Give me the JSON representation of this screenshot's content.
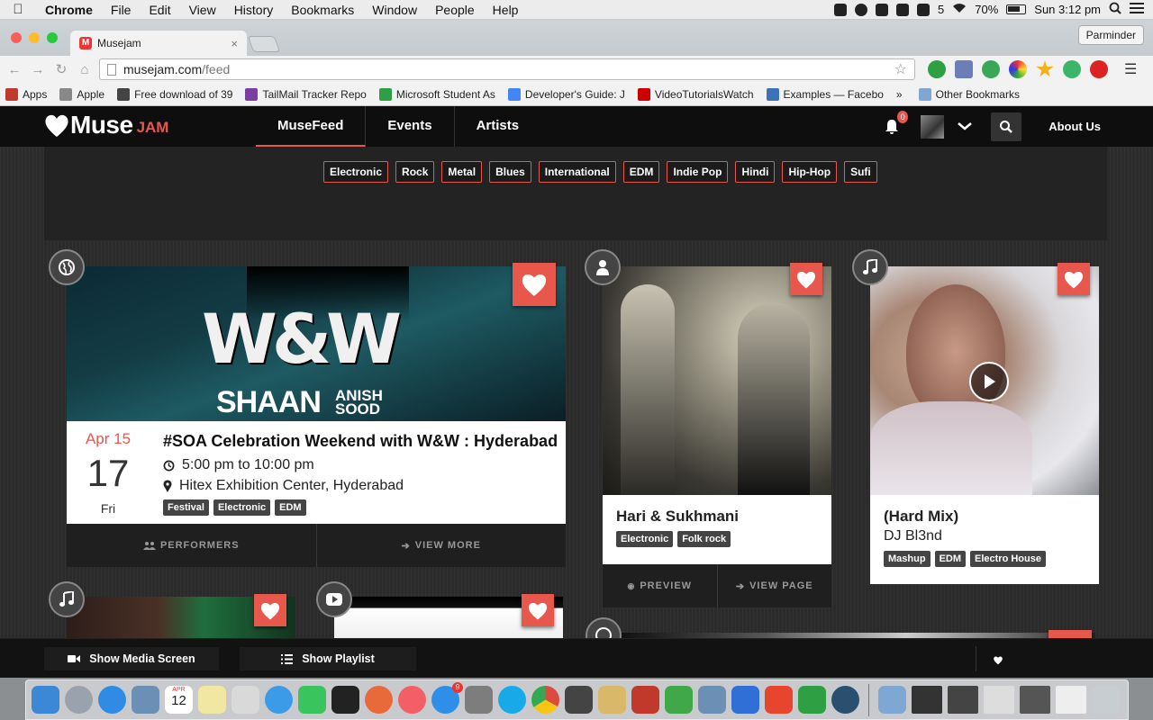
{
  "menubar": {
    "app": "Chrome",
    "items": [
      "File",
      "Edit",
      "View",
      "History",
      "Bookmarks",
      "Window",
      "People",
      "Help"
    ],
    "status_count": "5",
    "battery": "70%",
    "clock": "Sun 3:12 pm"
  },
  "browser": {
    "tab_title": "Musejam",
    "tab_close": "×",
    "profile": "Parminder",
    "url_host": "musejam.com",
    "url_path": "/feed",
    "bookmarks": [
      {
        "label": "Apps",
        "color": "#c0392b"
      },
      {
        "label": "Apple",
        "color": "#888888"
      },
      {
        "label": "Free download of 39",
        "color": "#444444"
      },
      {
        "label": "TailMail Tracker Repo",
        "color": "#7a3fa0"
      },
      {
        "label": "Microsoft Student As",
        "color": "#2ea043"
      },
      {
        "label": "Developer's Guide: J",
        "color": "#4285f4"
      },
      {
        "label": "VideoTutorialsWatch",
        "color": "#cc0000"
      },
      {
        "label": "Examples — Facebo",
        "color": "#3b73b9"
      }
    ],
    "bookmarks_more": "»",
    "other_bookmarks": "Other Bookmarks"
  },
  "site": {
    "logo_muse": "Muse",
    "logo_jam": "JAM",
    "nav": [
      {
        "label": "MuseFeed",
        "active": true
      },
      {
        "label": "Events",
        "active": false
      },
      {
        "label": "Artists",
        "active": false
      }
    ],
    "notif_count": "0",
    "about": "About Us"
  },
  "genres": [
    "Electronic",
    "Rock",
    "Metal",
    "Blues",
    "International",
    "EDM",
    "Indie Pop",
    "Hindi",
    "Hip-Hop",
    "Sufi"
  ],
  "event_card": {
    "poster_title": "W&W",
    "poster_line1": "SHAAN",
    "poster_line2a": "ANISH",
    "poster_line2b": "SOOD",
    "month_day": "Apr 15",
    "day": "17",
    "weekday": "Fri",
    "title": "#SOA Celebration Weekend with W&W : Hyderabad",
    "time": "5:00 pm to 10:00 pm",
    "venue": "Hitex Exhibition Center, Hyderabad",
    "tags": [
      "Festival",
      "Electronic",
      "EDM"
    ],
    "actions": [
      "PERFORMERS",
      "VIEW MORE"
    ]
  },
  "artist_card": {
    "title": "Hari & Sukhmani",
    "tags": [
      "Electronic",
      "Folk rock"
    ],
    "actions": [
      "PREVIEW",
      "VIEW PAGE"
    ]
  },
  "song_card": {
    "title": "(Hard Mix)",
    "artist": "DJ Bl3nd",
    "tags": [
      "Mashup",
      "EDM",
      "Electro House"
    ]
  },
  "mediabar": {
    "show_media": "Show Media Screen",
    "show_playlist": "Show Playlist"
  },
  "dock": {
    "calendar_day": "12",
    "calendar_month": "APR",
    "appstore_badge": "9",
    "app_colors": [
      "#3c87d6",
      "#9aa3ad",
      "#2f8be3",
      "#6b8fb5",
      "#f1e6a2",
      "#d9d9d9",
      "#3b9be8",
      "#3ac45e",
      "#222222",
      "#e86a3a",
      "#f25f66",
      "#2f8fe8",
      "#7d7d7d",
      "#17a9e8",
      "#dd4b3e",
      "#444444",
      "#d9b86a",
      "#c0392b",
      "#41a84a",
      "#6b8fb5",
      "#2f6fd6",
      "#e8452f",
      "#2ea043",
      "#2b4f6e"
    ]
  }
}
